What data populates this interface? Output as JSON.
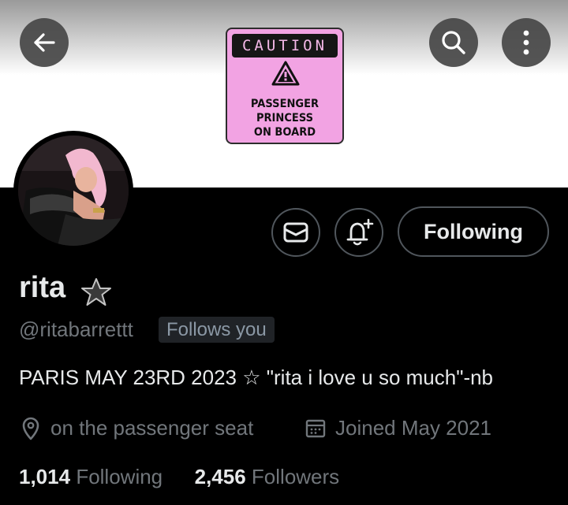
{
  "banner": {
    "sign_header": "CAUTION",
    "sign_lines": [
      "PASSENGER",
      "PRINCESS",
      "ON BOARD"
    ]
  },
  "icons": {
    "back": "arrow-left-icon",
    "search": "search-icon",
    "more": "more-vertical-icon",
    "message": "envelope-icon",
    "notify": "bell-plus-icon",
    "location": "location-pin-icon",
    "calendar": "calendar-icon",
    "verified_star": "star-icon",
    "warning": "warning-triangle-icon"
  },
  "profile": {
    "name": "rita",
    "handle": "@ritabarrettt",
    "follows_you": "Follows you",
    "bio": "PARIS MAY 23RD 2023 ☆ \"rita i love u so much\"-nb",
    "location": "on the passenger seat",
    "joined": "Joined May 2021",
    "following_count": "1,014",
    "following_label": "Following",
    "followers_count": "2,456",
    "followers_label": "Followers"
  },
  "actions": {
    "following_button": "Following"
  },
  "colors": {
    "background": "#000000",
    "text_primary": "#e7e9ea",
    "text_secondary": "#71767b",
    "sign_pink": "#f2a3e3"
  }
}
